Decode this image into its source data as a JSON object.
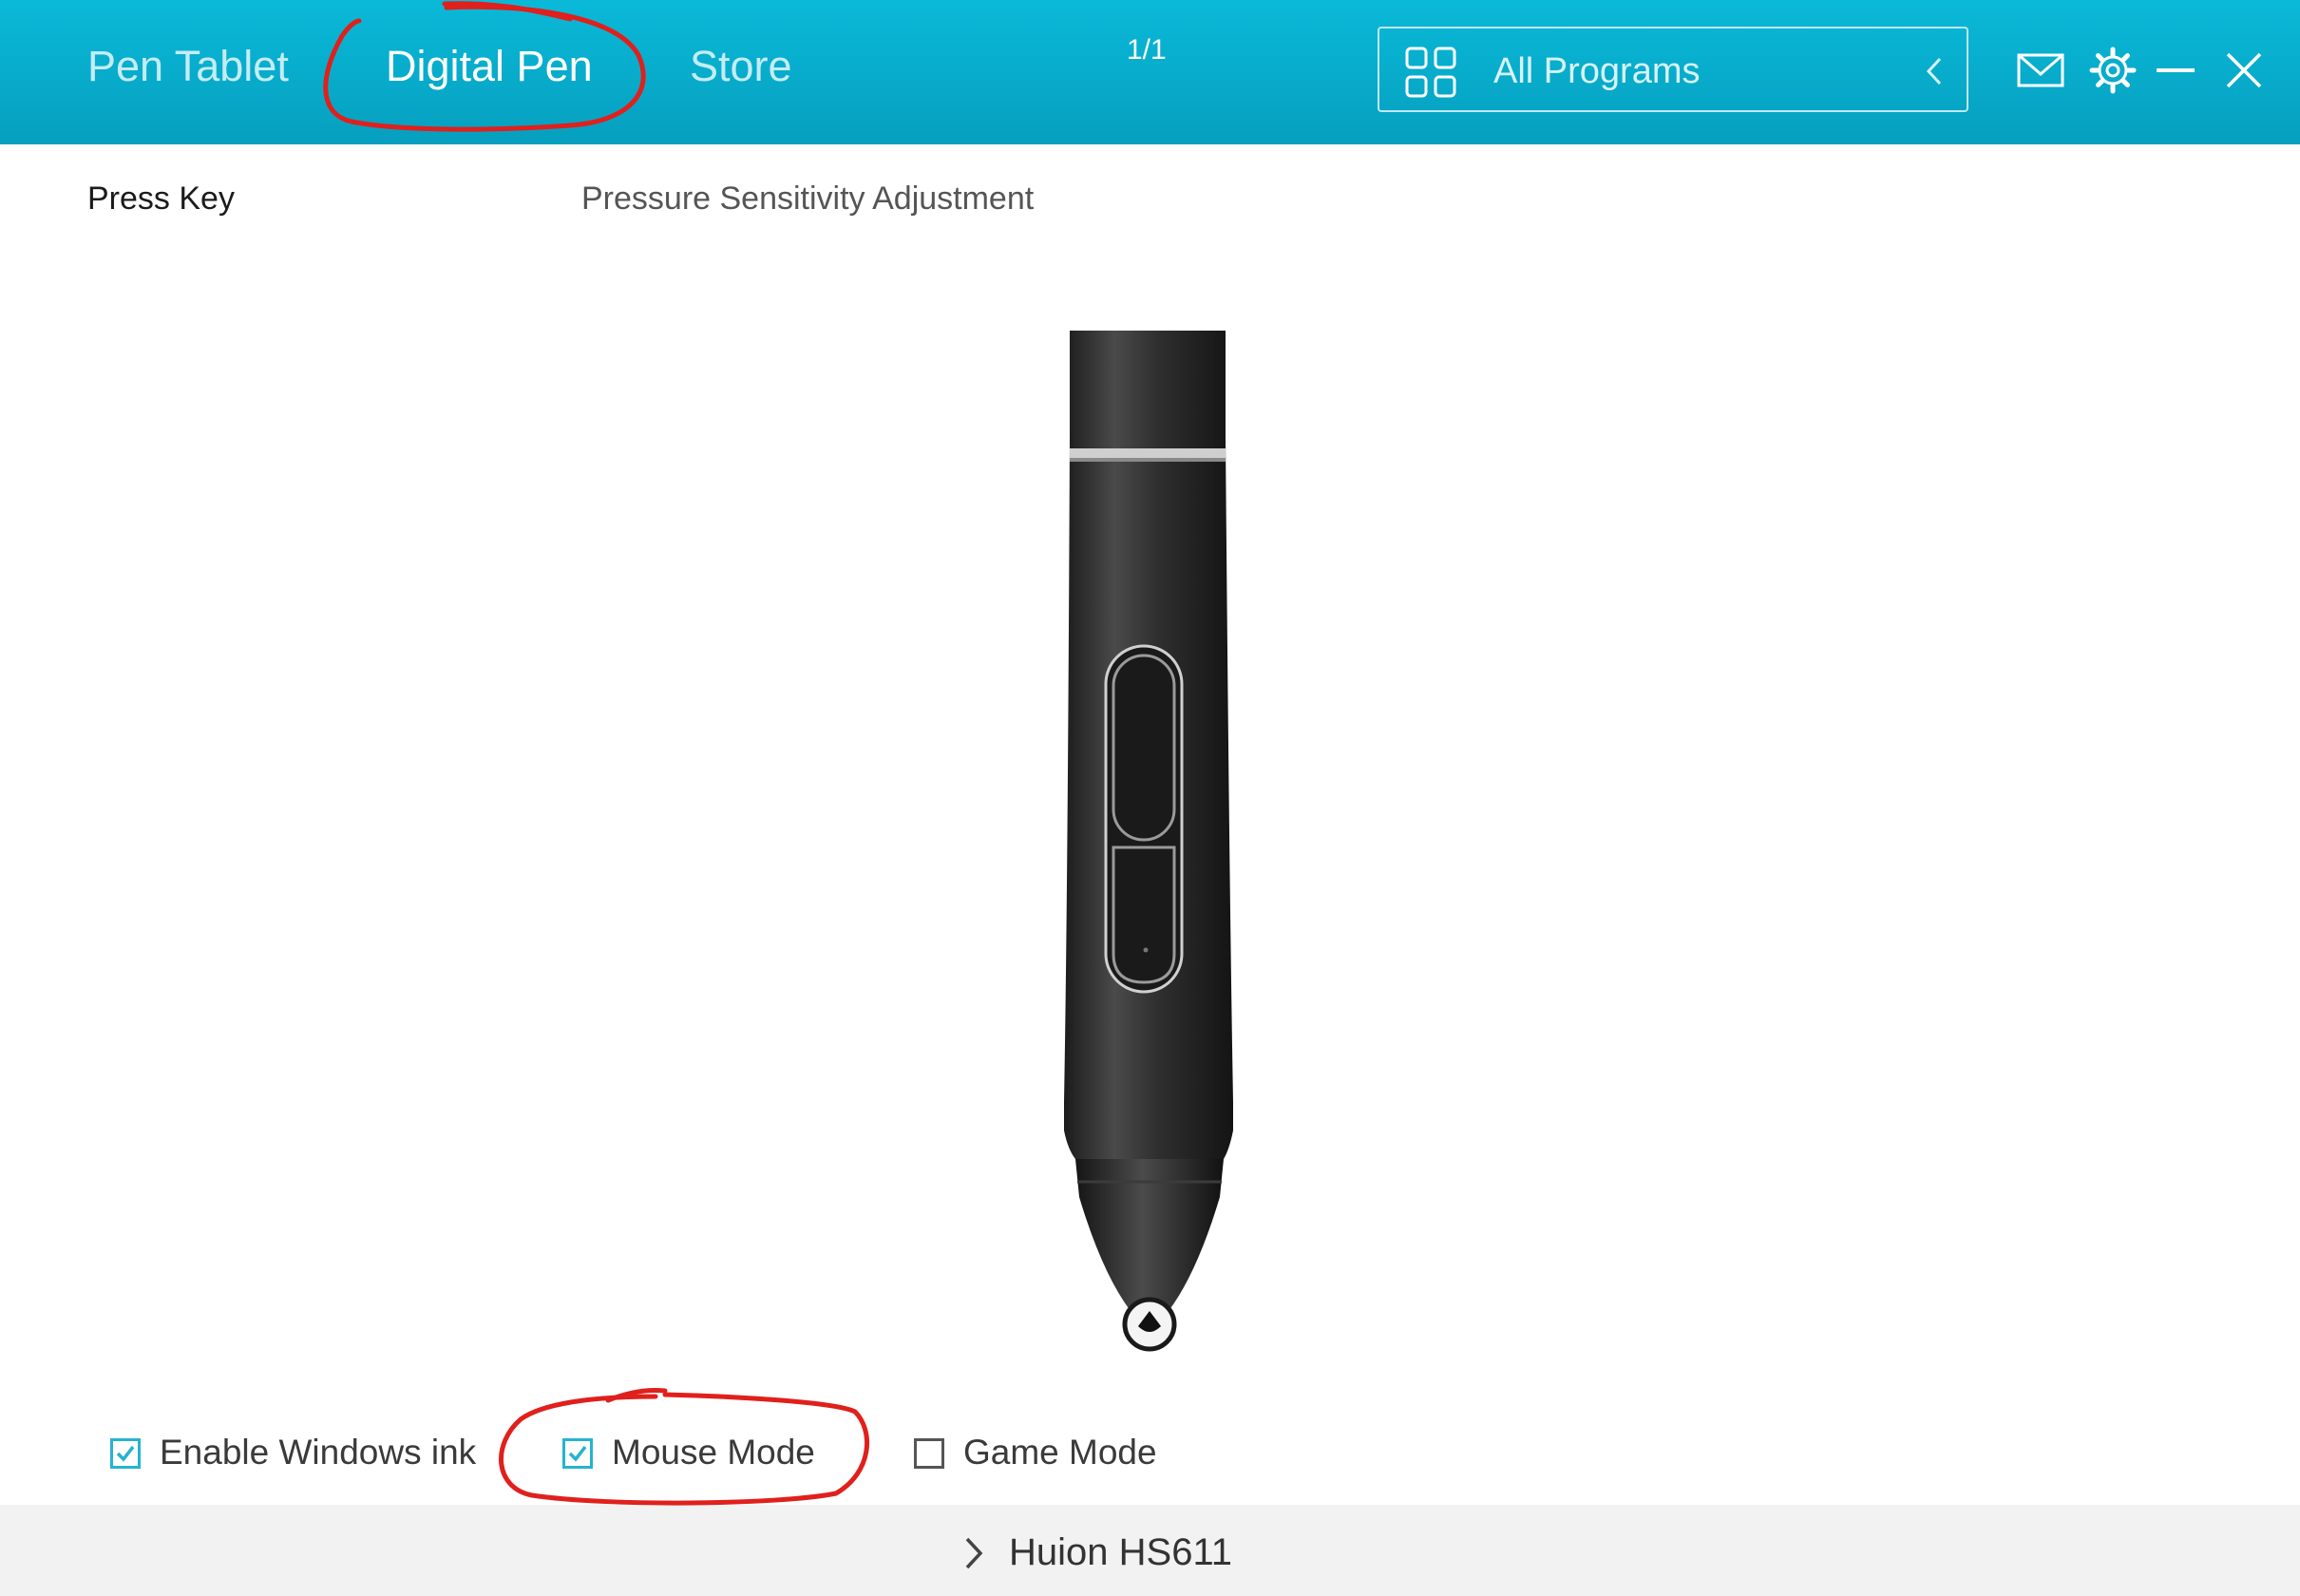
{
  "header": {
    "tabs": [
      {
        "label": "Pen Tablet",
        "active": false
      },
      {
        "label": "Digital Pen",
        "active": true
      },
      {
        "label": "Store",
        "active": false
      }
    ],
    "page_indicator": "1/1",
    "program_selector": {
      "label": "All Programs",
      "icon": "grid-icon",
      "arrow": "chevron-left-icon"
    },
    "window_icons": [
      "mail-icon",
      "gear-icon",
      "minimize-icon",
      "close-icon"
    ]
  },
  "pen_settings": {
    "tabs": [
      {
        "label": "Press Key",
        "active": true
      },
      {
        "label": "Pressure Sensitivity Adjustment",
        "active": false
      }
    ]
  },
  "options": [
    {
      "label": "Enable Windows ink",
      "checked": true
    },
    {
      "label": "Mouse Mode",
      "checked": true
    },
    {
      "label": "Game Mode",
      "checked": false
    }
  ],
  "footer": {
    "device_name": "Huion HS611",
    "icon": "chevron-right-icon"
  },
  "colors": {
    "header": "#06A9C8",
    "checkbox_accent": "#25B3CF",
    "annotation": "#E0201C",
    "footer_bg": "#F2F2F2"
  }
}
